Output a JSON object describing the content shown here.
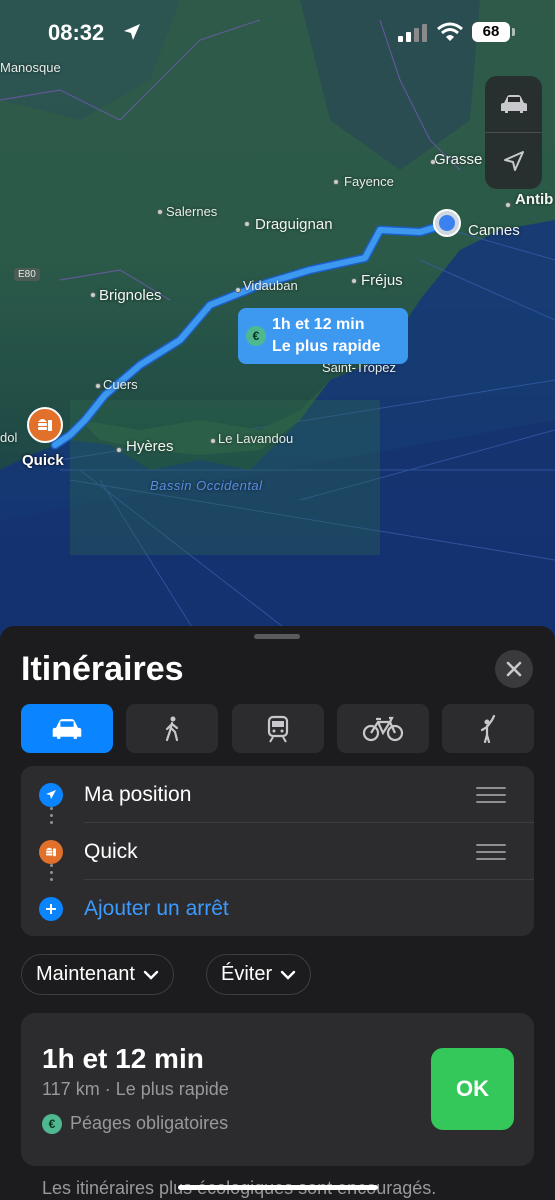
{
  "status_bar": {
    "time": "08:32",
    "battery": "68"
  },
  "map": {
    "places": [
      "Manosque",
      "Grasse",
      "Fayence",
      "Salernes",
      "Draguignan",
      "Antib",
      "Cannes",
      "Brignoles",
      "Vidauban",
      "Fréjus",
      "Saint-Tropez",
      "Cuers",
      "Hyères",
      "Le Lavandou",
      "dol"
    ],
    "road_badge": "E80",
    "sea_label": "Bassin Occidental",
    "route_callout": {
      "duration": "1h et 12 min",
      "tag": "Le plus rapide"
    },
    "destination_label": "Quick"
  },
  "sheet": {
    "title": "Itinéraires",
    "modes": [
      "car-icon",
      "walk-icon",
      "transit-icon",
      "bike-icon",
      "rideshare-icon"
    ],
    "selected_mode": "car-icon",
    "stops": [
      {
        "label": "Ma position",
        "icon": "location-arrow-icon"
      },
      {
        "label": "Quick",
        "icon": "restaurant-icon"
      },
      {
        "label": "Ajouter un arrêt",
        "icon": "plus-icon"
      }
    ],
    "when_label": "Maintenant",
    "avoid_label": "Éviter",
    "route": {
      "duration": "1h et 12 min",
      "details": "117 km · Le plus rapide",
      "tolls": "Péages obligatoires",
      "go_label": "OK"
    },
    "footnote": "Les itinéraires plus écologiques sont encouragés."
  },
  "colors": {
    "accent": "#0a84ff",
    "go": "#34c759",
    "route": "#3d98f0",
    "toll": "#4fb890"
  }
}
